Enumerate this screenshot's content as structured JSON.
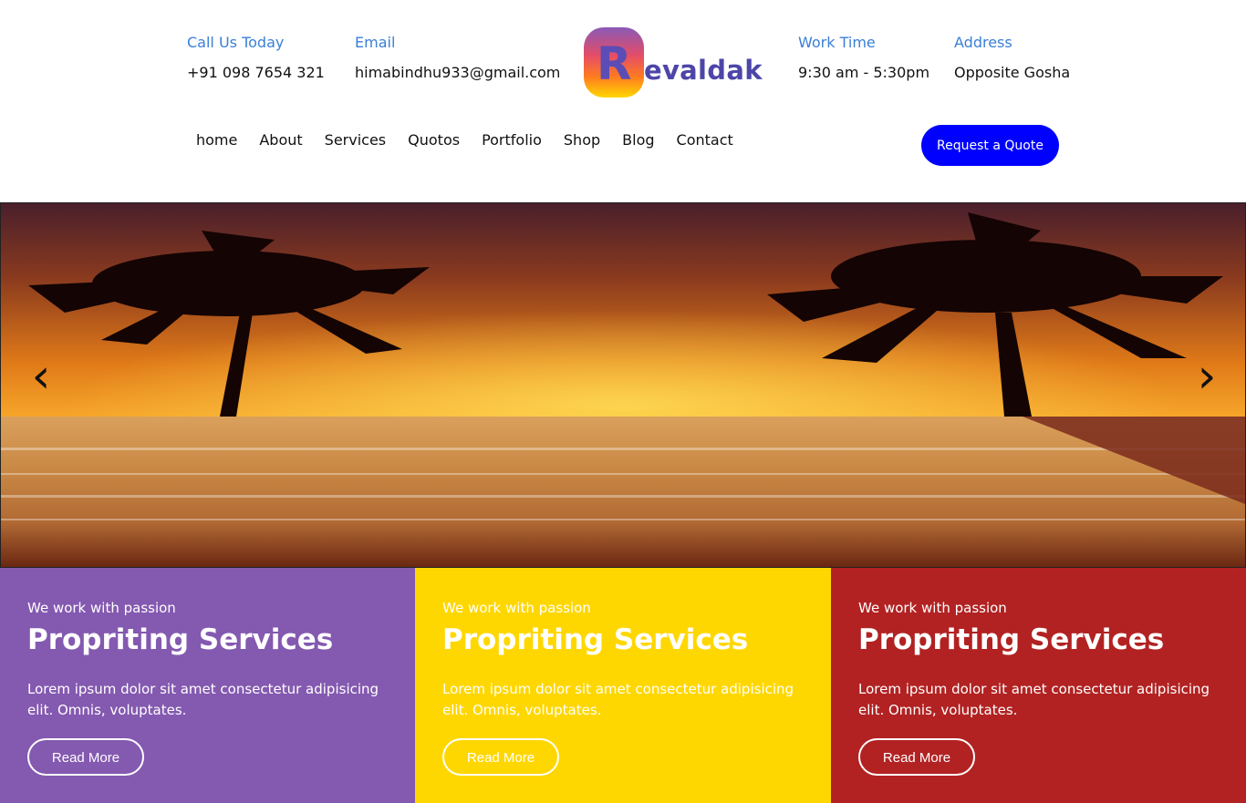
{
  "header": {
    "call": {
      "label": "Call Us Today",
      "value": "+91 098 7654 321"
    },
    "email": {
      "label": "Email",
      "value": "himabindhu933@gmail.com"
    },
    "work_time": {
      "label": "Work Time",
      "value": "9:30 am - 5:30pm"
    },
    "address": {
      "label": "Address",
      "value": "Opposite Gosha"
    },
    "logo": {
      "initial": "R",
      "word": "evaldak"
    },
    "cta_label": "Request a Quote"
  },
  "nav": {
    "items": [
      "home",
      "About",
      "Services",
      "Quotos",
      "Portfolio",
      "Shop",
      "Blog",
      "Contact"
    ]
  },
  "hero": {
    "prev_icon": "‹",
    "next_icon": "›"
  },
  "features": [
    {
      "eyebrow": "We work with passion",
      "title": "Propriting Services",
      "desc": "Lorem ipsum dolor sit amet consectetur adipisicing elit. Omnis, voluptates.",
      "button": "Read More",
      "color": "#8459b0"
    },
    {
      "eyebrow": "We work with passion",
      "title": "Propriting Services",
      "desc": "Lorem ipsum dolor sit amet consectetur adipisicing elit. Omnis, voluptates.",
      "button": "Read More",
      "color": "#ffd700"
    },
    {
      "eyebrow": "We work with passion",
      "title": "Propriting Services",
      "desc": "Lorem ipsum dolor sit amet consectetur adipisicing elit. Omnis, voluptates.",
      "button": "Read More",
      "color": "#b22222"
    }
  ],
  "colors": {
    "accent_blue": "#0000ff",
    "label_blue": "#3b7fd6",
    "logo_text": "#4d46a8"
  }
}
